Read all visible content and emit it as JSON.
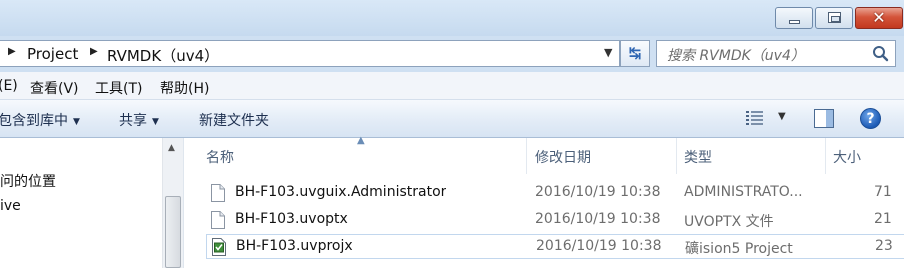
{
  "window": {
    "minimize_icon": "minimize-icon",
    "maximize_icon": "maximize-icon",
    "close_glyph": "✕"
  },
  "address": {
    "crumbs": [
      "Project",
      "RVMDK（uv4）"
    ],
    "search_placeholder": "搜索 RVMDK（uv4）"
  },
  "menu": {
    "items": [
      "(E)",
      "查看(V)",
      "工具(T)",
      "帮助(H)"
    ]
  },
  "commandbar": {
    "include_library": "包含到库中",
    "share": "共享",
    "new_folder": "新建文件夹"
  },
  "nav": {
    "items": [
      "问的位置",
      "ive"
    ]
  },
  "columns": {
    "name": "名称",
    "modified": "修改日期",
    "type": "类型",
    "size": "大小"
  },
  "files": [
    {
      "name": "BH-F103.uvguix.Administrator",
      "modified": "2016/10/19 10:38",
      "type": "ADMINISTRATO...",
      "size": "71",
      "icon": "generic-file-icon"
    },
    {
      "name": "BH-F103.uvoptx",
      "modified": "2016/10/19 10:38",
      "type": "UVOPTX 文件",
      "size": "21",
      "icon": "generic-file-icon"
    },
    {
      "name": "BH-F103.uvprojx",
      "modified": "2016/10/19 10:38",
      "type": "礦ision5 Project",
      "size": "23",
      "icon": "keil-project-icon"
    }
  ],
  "colors": {
    "chrome_blue": "#cfe0f2",
    "header_text": "#4c607a",
    "secondary_text": "#6d6d6d",
    "close_red": "#c2381f"
  }
}
